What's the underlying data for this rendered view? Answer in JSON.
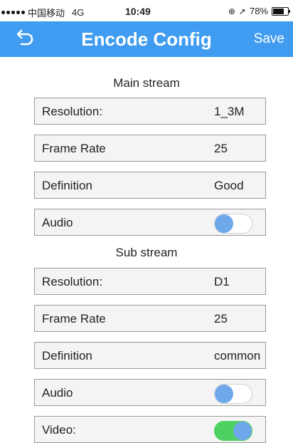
{
  "status_bar": {
    "carrier": "中国移动",
    "network": "4G",
    "time": "10:49",
    "battery": "78%",
    "battery_level": 0.78
  },
  "nav": {
    "title": "Encode Config",
    "save_label": "Save",
    "background": "#3f9cf0"
  },
  "main_stream": {
    "title": "Main stream",
    "resolution_label": "Resolution:",
    "resolution_value": "1_3M",
    "frame_rate_label": "Frame Rate",
    "frame_rate_value": "25",
    "definition_label": "Definition",
    "definition_value": "Good",
    "audio_label": "Audio",
    "audio_on": false
  },
  "sub_stream": {
    "title": "Sub stream",
    "resolution_label": "Resolution:",
    "resolution_value": "D1",
    "frame_rate_label": "Frame Rate",
    "frame_rate_value": "25",
    "definition_label": "Definition",
    "definition_value": "common",
    "audio_label": "Audio",
    "audio_on": false,
    "video_label": "Video:",
    "video_on": true
  },
  "colors": {
    "toggle_on": "#4ecf62",
    "toggle_knob": "#6fa8ea"
  }
}
